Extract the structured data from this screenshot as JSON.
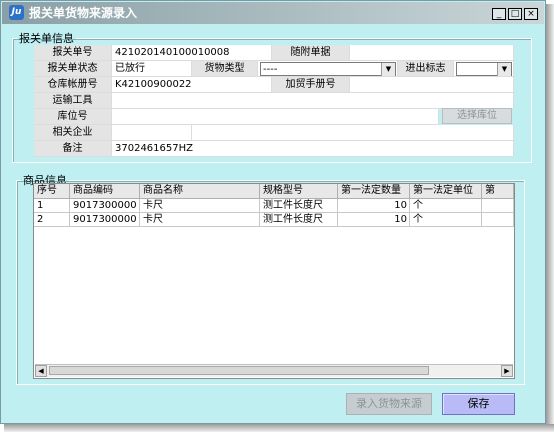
{
  "window": {
    "title": "报关单货物来源录入",
    "min": "_",
    "max": "□",
    "close": "×"
  },
  "header": {
    "legend": "报关单信息",
    "labels": {
      "decl_no": "报关单号",
      "attached": "随附单据",
      "status": "报关单状态",
      "goods_type": "货物类型",
      "io_flag": "进出标志",
      "warehouse_book": "仓库帐册号",
      "trade_manual": "加贸手册号",
      "transport": "运输工具",
      "location": "库位号",
      "company": "相关企业",
      "remark": "备注"
    },
    "values": {
      "decl_no": "421020140100010008",
      "status": "已放行",
      "goods_type": "----",
      "io_flag": "",
      "warehouse_book": "K42100900022",
      "remark": "3702461657HZ"
    },
    "select_location_button": "选择库位"
  },
  "goods": {
    "legend": "商品信息",
    "columns": [
      "序号",
      "商品编码",
      "商品名称",
      "规格型号",
      "第一法定数量",
      "第一法定单位",
      "第"
    ],
    "rows": [
      [
        "1",
        "9017300000",
        "卡尺",
        "测工件长度尺",
        "10",
        "个"
      ],
      [
        "2",
        "9017300000",
        "卡尺",
        "测工件长度尺",
        "10",
        "个"
      ]
    ]
  },
  "buttons": {
    "enter_source": "录入货物来源",
    "save": "保存"
  }
}
